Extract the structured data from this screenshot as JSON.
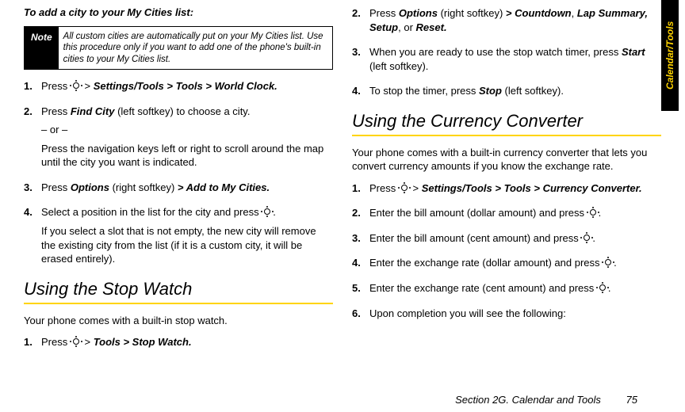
{
  "sideTab": "Calendar/Tools",
  "leftCol": {
    "leadIn": "To add a city to your My Cities list:",
    "note": {
      "label": "Note",
      "text": "All custom cities are automatically put on your My Cities list. Use this procedure only if you want to add one of the phone's built-in cities to your My Cities list."
    },
    "steps": {
      "s1_a": "Press ",
      "s1_b": " > ",
      "s1_path": "Settings/Tools > Tools > World Clock.",
      "s2_a": "Press ",
      "s2_findCity": "Find City",
      "s2_b": " (left softkey) to choose a city.",
      "s2_or": "– or –",
      "s2_c": "Press the navigation keys left or right to scroll around the map until the city you want is indicated.",
      "s3_a": "Press ",
      "s3_options": "Options",
      "s3_b": " (right softkey) ",
      "s3_gt": "> ",
      "s3_add": "Add to My Cities.",
      "s4_a": "Select a position in the list for the city and press ",
      "s4_b": ".",
      "s4_c": "If you select a slot that is not empty, the new city will remove the existing city from the list (if it is a custom city, it will be erased entirely)."
    },
    "h2a": "Using the Stop Watch",
    "introA": "Your phone comes with a built-in stop watch.",
    "sw1_a": "Press ",
    "sw1_b": " > ",
    "sw1_path": "Tools > Stop Watch."
  },
  "rightCol": {
    "sw2_a": "Press ",
    "sw2_options": "Options",
    "sw2_b": " (right softkey) ",
    "sw2_gt": "> ",
    "sw2_cd": "Countdown",
    "sw2_c": ", ",
    "sw2_lap": "Lap Summary, Setup",
    "sw2_d": ", or ",
    "sw2_reset": "Reset.",
    "sw3_a": "When you are ready to use the stop watch timer, press ",
    "sw3_start": "Start",
    "sw3_b": " (left softkey).",
    "sw4_a": "To stop the timer, press ",
    "sw4_stop": "Stop",
    "sw4_b": " (left softkey).",
    "h2b": "Using the Currency Converter",
    "introB": "Your phone comes with a built-in currency converter that lets you convert currency amounts if you know the exchange rate.",
    "cc1_a": "Press ",
    "cc1_b": " > ",
    "cc1_path": "Settings/Tools > Tools > Currency Converter.",
    "cc2_a": "Enter the bill amount (dollar amount) and press ",
    "cc2_b": ".",
    "cc3_a": "Enter the bill amount (cent amount) and press ",
    "cc3_b": ".",
    "cc4_a": "Enter the exchange rate (dollar amount) and press ",
    "cc4_b": ".",
    "cc5_a": "Enter the exchange rate (cent amount) and press ",
    "cc5_b": ".",
    "cc6": "Upon completion you will see the following:"
  },
  "footer": {
    "section": "Section 2G. Calendar and Tools",
    "page": "75"
  }
}
